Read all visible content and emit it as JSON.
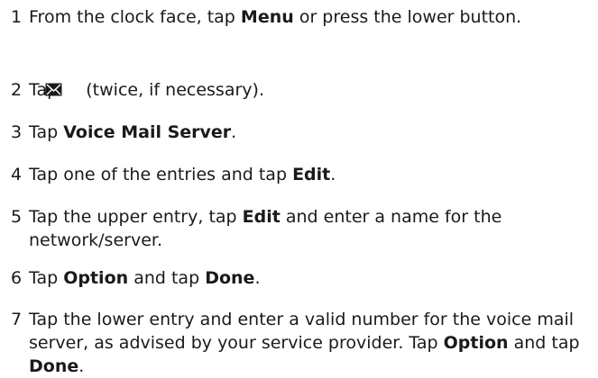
{
  "steps": [
    {
      "num": "1",
      "parts": [
        "From the clock face, tap ",
        "Menu",
        " or press the lower button."
      ]
    },
    {
      "num": "2",
      "parts": [
        "Tap ",
        "",
        " (twice, if necessary)."
      ],
      "icon": "envelope-icon"
    },
    {
      "num": "3",
      "parts": [
        "Tap ",
        "Voice Mail Server",
        "."
      ]
    },
    {
      "num": "4",
      "parts": [
        "Tap one of the entries and tap ",
        "Edit",
        "."
      ]
    },
    {
      "num": "5",
      "parts": [
        "Tap the upper entry, tap ",
        "Edit",
        " and enter a name for the network/server."
      ]
    },
    {
      "num": "6",
      "parts": [
        "Tap ",
        "Option",
        " and tap ",
        "Done",
        "."
      ]
    },
    {
      "num": "7",
      "parts": [
        "Tap the lower entry and enter a valid number for the voice mail server, as advised by your service provider. Tap ",
        "Option",
        " and tap ",
        "Done",
        "."
      ]
    }
  ]
}
